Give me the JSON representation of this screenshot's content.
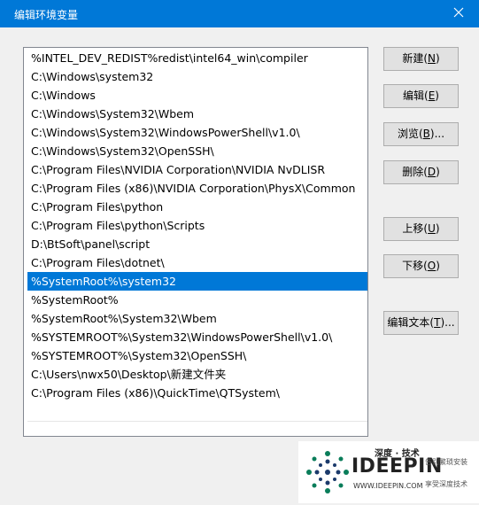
{
  "window": {
    "title": "编辑环境变量",
    "close_icon": "close-icon"
  },
  "list": {
    "selected_index": 12,
    "items": [
      "%INTEL_DEV_REDIST%redist\\intel64_win\\compiler",
      "C:\\Windows\\system32",
      "C:\\Windows",
      "C:\\Windows\\System32\\Wbem",
      "C:\\Windows\\System32\\WindowsPowerShell\\v1.0\\",
      "C:\\Windows\\System32\\OpenSSH\\",
      "C:\\Program Files\\NVIDIA Corporation\\NVIDIA NvDLISR",
      "C:\\Program Files (x86)\\NVIDIA Corporation\\PhysX\\Common",
      "C:\\Program Files\\python",
      "C:\\Program Files\\python\\Scripts",
      "D:\\BtSoft\\panel\\script",
      "C:\\Program Files\\dotnet\\",
      "%SystemRoot%\\system32",
      "%SystemRoot%",
      "%SystemRoot%\\System32\\Wbem",
      "%SYSTEMROOT%\\System32\\WindowsPowerShell\\v1.0\\",
      "%SYSTEMROOT%\\System32\\OpenSSH\\",
      "C:\\Users\\nwx50\\Desktop\\新建文件夹",
      "C:\\Program Files (x86)\\QuickTime\\QTSystem\\"
    ]
  },
  "buttons": {
    "new": {
      "label": "新建(",
      "hotkey": "N",
      "suffix": ")"
    },
    "edit": {
      "label": "编辑(",
      "hotkey": "E",
      "suffix": ")"
    },
    "browse": {
      "label": "浏览(",
      "hotkey": "B",
      "suffix": ")..."
    },
    "delete": {
      "label": "删除(",
      "hotkey": "D",
      "suffix": ")"
    },
    "move_up": {
      "label": "上移(",
      "hotkey": "U",
      "suffix": ")"
    },
    "move_down": {
      "label": "下移(",
      "hotkey": "O",
      "suffix": ")"
    },
    "edit_text": {
      "label": "编辑文本(",
      "hotkey": "T",
      "suffix": ")..."
    }
  },
  "watermark": {
    "top": "深度 · 技术",
    "brand": "IDEEPIN",
    "url": "WWW.IDEEPIN.COM",
    "right_top": "告别繁琐安装",
    "right_bottom": "享受深度技术"
  },
  "colors": {
    "accent": "#0078d7",
    "selection": "#0078d7",
    "brand_green": "#0a7d5a"
  }
}
